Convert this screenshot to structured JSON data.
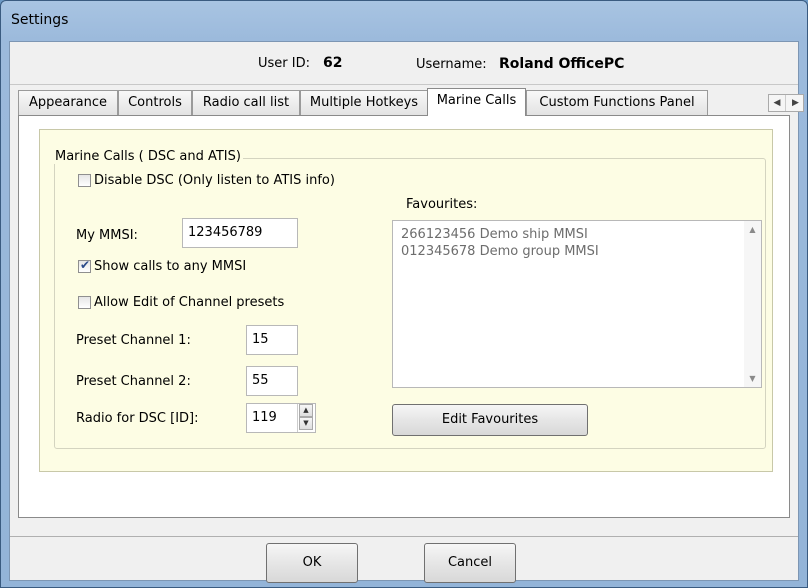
{
  "window": {
    "title": "Settings"
  },
  "user": {
    "id_label": "User ID:",
    "id_value": "62",
    "name_label": "Username:",
    "name_value": "Roland OfficePC"
  },
  "tabs": [
    {
      "label": "Appearance",
      "active": false
    },
    {
      "label": "Controls",
      "active": false
    },
    {
      "label": "Radio call list",
      "active": false
    },
    {
      "label": "Multiple Hotkeys",
      "active": false
    },
    {
      "label": "Marine Calls",
      "active": true
    },
    {
      "label": "Custom Functions Panel",
      "active": false
    }
  ],
  "marine": {
    "group_title": "Marine Calls ( DSC and ATIS)",
    "disable_dsc": {
      "label": "Disable DSC (Only listen to ATIS info)",
      "checked": false
    },
    "my_mmsi_label": "My MMSI:",
    "my_mmsi_value": "123456789",
    "show_calls": {
      "label": "Show calls to any MMSI",
      "checked": true
    },
    "allow_edit": {
      "label": "Allow Edit of Channel presets",
      "checked": false
    },
    "preset1_label": "Preset Channel 1:",
    "preset1_value": "15",
    "preset2_label": "Preset Channel 2:",
    "preset2_value": "55",
    "radio_dsc_label": "Radio for DSC [ID]:",
    "radio_dsc_value": "119",
    "favourites_label": "Favourites:",
    "favourites": [
      "266123456 Demo ship MMSI",
      "012345678 Demo group MMSI"
    ],
    "edit_favourites_label": "Edit Favourites"
  },
  "footer": {
    "ok_label": "OK",
    "cancel_label": "Cancel"
  },
  "icons": {
    "tab_scroll_left": "left-arrow-icon",
    "tab_scroll_right": "right-arrow-icon",
    "scroll_up": "up-arrow-icon",
    "scroll_down": "down-arrow-icon",
    "checkmark": "checkmark-icon"
  },
  "colors": {
    "panel_background": "#fdfde4",
    "titlebar": "#9cbadc"
  }
}
